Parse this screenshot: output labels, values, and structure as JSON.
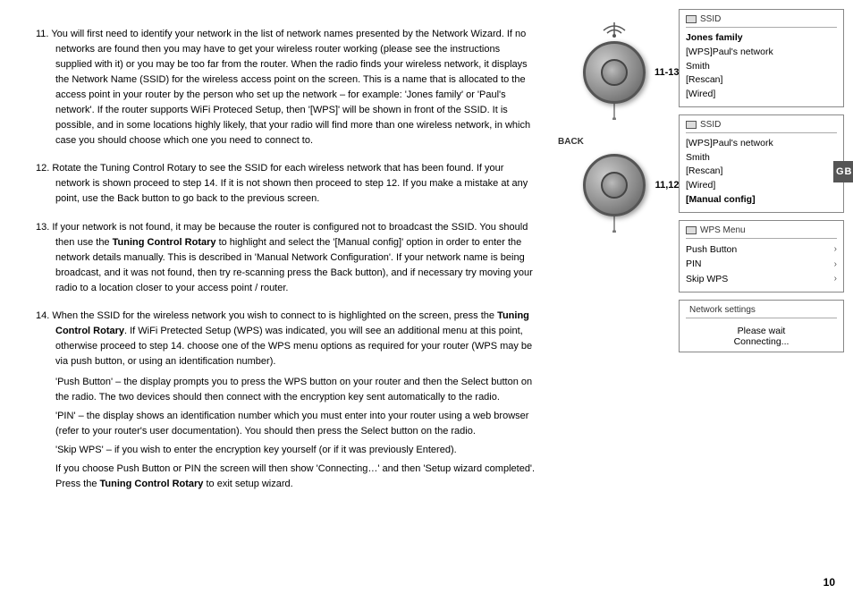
{
  "page": {
    "number": "10",
    "gb_label": "GB"
  },
  "instructions": [
    {
      "number": "11.",
      "text": "You will first need to identify your network in the list of network names presented by the Network Wizard. If no networks are found then you  may have to get your wireless router working (please see the instructions supplied with it) or you may be too far from the router. When the radio finds your wireless network, it displays the Network Name (SSID) for the wireless access point on the screen. This is a name that is allocated to the access point in your router by the person who set up the network – for example: 'Jones family' or 'Paul's network'. If the router supports WiFi Proteced Setup, then '[WPS]' will be shown in front of the SSID. It is possible, and in some locations highly likely, that your radio will find more than one wireless network, in which case you should choose which one you need to connect to."
    },
    {
      "number": "12.",
      "text": "Rotate the Tuning Control Rotary to see the SSID for each wireless network that has been found. If your network is shown proceed to step 14. If it is not shown then proceed to step 12. If you make a mistake at any point, use the Back button to go back to the previous screen."
    },
    {
      "number": "13.",
      "text_parts": [
        {
          "text": "If your network is not found, it may be because the router is configured not to broadcast the SSID. You should then use the "
        },
        {
          "text": "Tuning Control Rotary",
          "bold": true
        },
        {
          "text": " to highlight and select the '[Manual config]' option in order to enter the network details manually. This is described in 'Manual Network Configuration'. If your network name is being broadcast, and it was not found, then try re-scanning press the Back button), and if necessary try moving your radio to a location closer to your access point / router."
        }
      ]
    },
    {
      "number": "14.",
      "text_parts": [
        {
          "text": "When the SSID for the wireless network you wish to connect to is highlighted on the screen, press the "
        },
        {
          "text": "Tuning Control Rotary",
          "bold": true
        },
        {
          "text": ". If WiFi Pretected Setup (WPS) was indicated, you will see an additional menu at this point, otherwise proceed to step 14. choose one of the WPS menu options as required for your router (WPS may be via push button, or using an identification number)."
        },
        {
          "text": "\n'Push Button' – the display prompts you to press the WPS button on your router and then the Select button on the radio. The two devices should then connect with the encryption key sent automatically to the radio.\n'PIN' – the display shows an identification number which you must enter into your router using a web browser (refer to your router's user documentation). You should then press the Select button on the radio.\n'Skip WPS' – if you wish to enter the encryption key yourself (or if it was previously Entered).\nIf you choose Push Button or PIN the screen will then show 'Connecting…' and then 'Setup wizard completed'. Press the "
        },
        {
          "text": "Tuning Control Rotary",
          "bold": true
        },
        {
          "text": " to exit setup wizard."
        }
      ]
    }
  ],
  "center": {
    "step1_label": "11-13",
    "back_label": "BACK",
    "step2_label": "11,12"
  },
  "ui_panels": {
    "ssid_panel1": {
      "header": "SSID",
      "items": [
        {
          "text": "Jones family",
          "bold": true
        },
        {
          "text": "[WPS]Paul's network"
        },
        {
          "text": "Smith"
        },
        {
          "text": "[Rescan]"
        },
        {
          "text": "[Wired]"
        }
      ]
    },
    "ssid_panel2": {
      "header": "SSID",
      "items": [
        {
          "text": "[WPS]Paul's network"
        },
        {
          "text": "Smith"
        },
        {
          "text": "[Rescan]"
        },
        {
          "text": "[Wired]"
        },
        {
          "text": "[Manual config]",
          "bold": true
        }
      ]
    },
    "wps_menu": {
      "header": "WPS Menu",
      "items": [
        {
          "text": "Push Button",
          "bold": true,
          "arrow": true
        },
        {
          "text": "PIN",
          "arrow": true
        },
        {
          "text": "Skip WPS",
          "arrow": true
        }
      ]
    },
    "network_settings": {
      "header": "Network settings",
      "line1": "Please wait",
      "line2": "Connecting..."
    }
  }
}
